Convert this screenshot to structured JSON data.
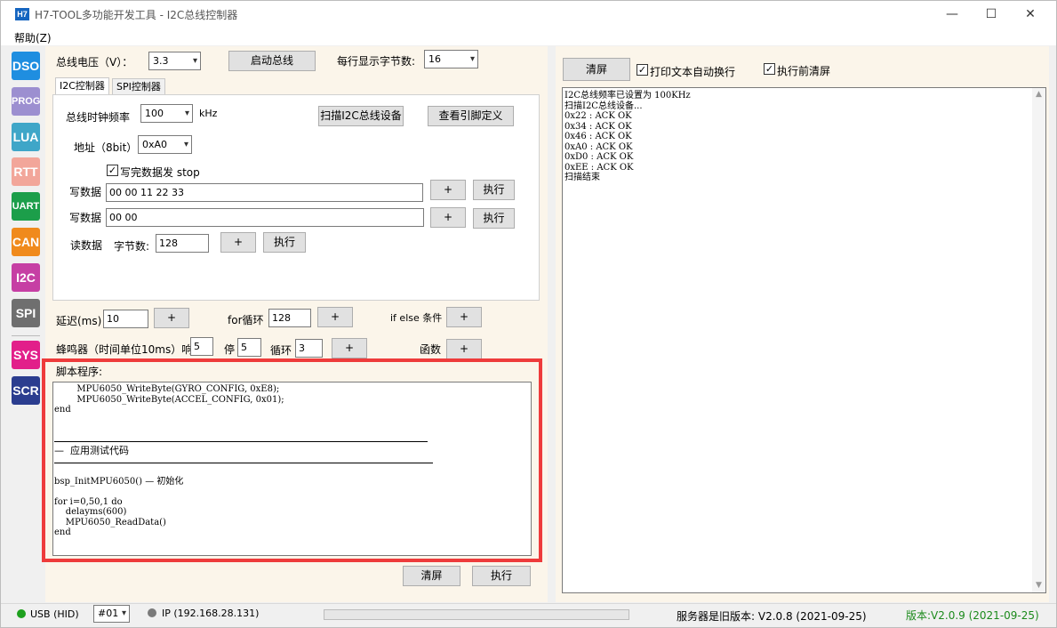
{
  "window": {
    "icon_label": "H7",
    "title": "H7-TOOL多功能开发工具 - I2C总线控制器",
    "minimize": "—",
    "maximize": "☐",
    "close": "✕"
  },
  "menu": {
    "help": "帮助(Z)"
  },
  "tools": [
    {
      "label": "DSO",
      "color": "#1f8ee0"
    },
    {
      "label": "PROG",
      "color": "#9c8fd0"
    },
    {
      "label": "LUA",
      "color": "#3fa6c8"
    },
    {
      "label": "RTT",
      "color": "#f2a69a"
    },
    {
      "label": "UART",
      "color": "#1c9e4a"
    },
    {
      "label": "CAN",
      "color": "#f08a1c"
    },
    {
      "label": "I2C",
      "color": "#c63fa4"
    },
    {
      "label": "SPI",
      "color": "#6f6f6f"
    },
    {
      "label": "SYS",
      "color": "#e21f8a"
    },
    {
      "label": "SCR",
      "color": "#2b3d8f"
    }
  ],
  "top": {
    "voltage_label": "总线电压（V）：",
    "voltage_value": "3.3",
    "start_bus": "启动总线",
    "bytes_per_line_label": "每行显示字节数:",
    "bytes_per_line_value": "16"
  },
  "tabs": {
    "i2c": "I2C控制器",
    "spi": "SPI控制器"
  },
  "i2c": {
    "clock_label": "总线时钟频率",
    "clock_value": "100",
    "clock_unit": "kHz",
    "scan_button": "扫描I2C总线设备",
    "pin_button": "查看引脚定义",
    "addr_label": "地址（8bit）",
    "addr_value": "0xA0",
    "stop_check": "✓",
    "stop_label": "写完数据发 stop",
    "write1_label": "写数据",
    "write1_value": "00 00 11 22 33",
    "write2_label": "写数据",
    "write2_value": "00 00",
    "plus": "+",
    "exec": "执行",
    "read_label": "读数据",
    "read_bytes_label": "字节数:",
    "read_bytes_value": "128"
  },
  "delay": {
    "label": "延迟(ms)",
    "value": "10",
    "plus": "+",
    "for_label": "for循环",
    "for_value": "128",
    "ifelse_label": "if else 条件"
  },
  "beeper": {
    "label": "蜂鸣器（时间单位10ms）响",
    "on_value": "5",
    "stop_label": "停",
    "stop_value": "5",
    "loop_label": "循环",
    "loop_value": "3",
    "func_label": "函数"
  },
  "script": {
    "title": "脚本程序:",
    "lines": [
      "        MPU6050_WriteByte(GYRO_CONFIG, 0xE8);",
      "        MPU6050_WriteByte(ACCEL_CONFIG, 0x01);",
      "end",
      "",
      "",
      "",
      "—  应用测试代码",
      "",
      "",
      "bsp_InitMPU6050() — 初始化",
      "",
      "for i=0,50,1 do",
      "    delayms(600)",
      "    MPU6050_ReadData()",
      "end"
    ],
    "clear": "清屏",
    "run": "执行"
  },
  "right": {
    "clear": "清屏",
    "wrap_check": "✓",
    "wrap_label": "打印文本自动换行",
    "clear_before_check": "✓",
    "clear_before_label": "执行前清屏",
    "log": [
      "I2C总线频率已设置为 100KHz",
      "扫描I2C总线设备...",
      "0x22 : ACK OK",
      "0x34 : ACK OK",
      "0x46 : ACK OK",
      "0xA0 : ACK OK",
      "0xD0 : ACK OK",
      "0xEE : ACK OK",
      "扫描结束"
    ]
  },
  "status": {
    "usb": "USB (HID)",
    "usb_color": "#1ea01e",
    "device": "#01",
    "ip": "IP (192.168.28.131)",
    "ip_color": "#7a7a7a",
    "server": "服务器是旧版本: V2.0.8 (2021-09-25)",
    "version": "版本:V2.0.9 (2021-09-25)",
    "version_color": "#1b8a1b"
  }
}
